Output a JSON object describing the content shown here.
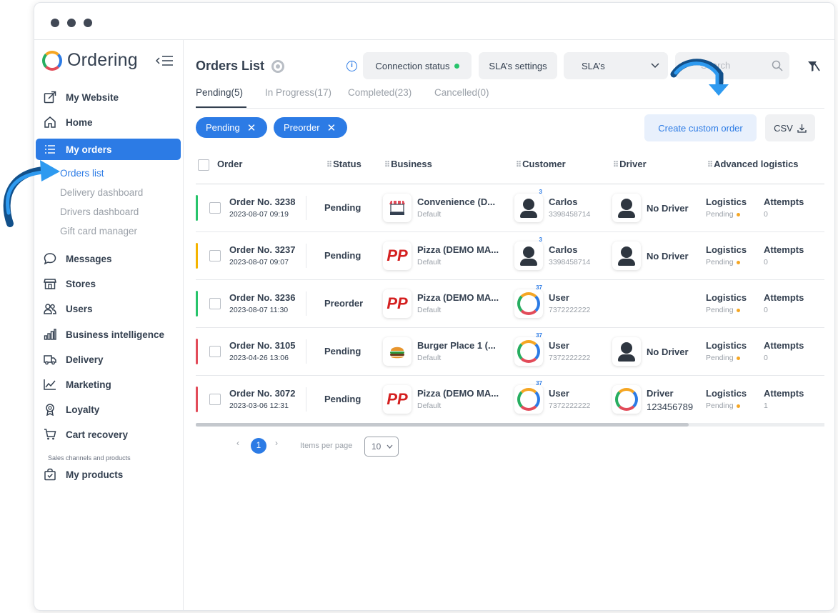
{
  "app": {
    "logo_text": "Ordering",
    "brand_color": "#2c7be5"
  },
  "sidebar": {
    "items": [
      {
        "label": "My Website",
        "icon": "external-link-icon"
      },
      {
        "label": "Home",
        "icon": "home-icon"
      },
      {
        "label": "My orders",
        "icon": "list-icon",
        "active": true
      },
      {
        "label": "Messages",
        "icon": "chat-icon"
      },
      {
        "label": "Stores",
        "icon": "store-icon"
      },
      {
        "label": "Users",
        "icon": "users-icon"
      },
      {
        "label": "Business intelligence",
        "icon": "bar-chart-icon"
      },
      {
        "label": "Delivery",
        "icon": "truck-icon"
      },
      {
        "label": "Marketing",
        "icon": "trend-icon"
      },
      {
        "label": "Loyalty",
        "icon": "award-icon"
      },
      {
        "label": "Cart recovery",
        "icon": "cart-icon"
      },
      {
        "label": "My products",
        "icon": "bag-icon"
      }
    ],
    "sub_items": [
      "Orders list",
      "Delivery dashboard",
      "Drivers dashboard",
      "Gift card manager"
    ],
    "section_label": "Sales channels and products"
  },
  "header": {
    "title": "Orders List",
    "connection_status": "Connection status",
    "sla_settings": "SLA’s settings",
    "sla_select": "SLA’s",
    "search_placeholder": "Search"
  },
  "tabs": [
    "Pending(5)",
    "In Progress(17)",
    "Completed(23)",
    "Cancelled(0)"
  ],
  "chips": [
    "Pending",
    "Preorder"
  ],
  "actions": {
    "create_custom_order": "Create custom order",
    "csv": "CSV"
  },
  "table": {
    "columns": [
      "Order",
      "Status",
      "Business",
      "Customer",
      "Driver",
      "Advanced logistics"
    ],
    "rows": [
      {
        "order": "Order No. 3238",
        "date": "2023-08-07 09:19",
        "status": "Pending",
        "business": "Convenience (D...",
        "business_sub": "Default",
        "customer": "Carlos",
        "phone": "3398458714",
        "badge": "3",
        "driver": "No Driver",
        "driver_sub": "",
        "logistics": "Logistics",
        "logistics_status": "Pending",
        "attempts_label": "Attempts",
        "attempts": "0",
        "bar_color": "#27c46b"
      },
      {
        "order": "Order No. 3237",
        "date": "2023-08-07 09:07",
        "status": "Pending",
        "business": "Pizza (DEMO MA...",
        "business_sub": "Default",
        "customer": "Carlos",
        "phone": "3398458714",
        "badge": "3",
        "driver": "No Driver",
        "driver_sub": "",
        "logistics": "Logistics",
        "logistics_status": "Pending",
        "attempts_label": "Attempts",
        "attempts": "0",
        "bar_color": "#f5b400"
      },
      {
        "order": "Order No. 3236",
        "date": "2023-08-07 11:30",
        "status": "Preorder",
        "business": "Pizza (DEMO MA...",
        "business_sub": "Default",
        "customer": "User",
        "phone": "7372222222",
        "badge": "37",
        "driver": "",
        "driver_sub": "",
        "logistics": "Logistics",
        "logistics_status": "Pending",
        "attempts_label": "Attempts",
        "attempts": "0",
        "bar_color": "#27c46b"
      },
      {
        "order": "Order No. 3105",
        "date": "2023-04-26 13:06",
        "status": "Pending",
        "business": "Burger Place 1 (...",
        "business_sub": "Default",
        "customer": "User",
        "phone": "7372222222",
        "badge": "37",
        "driver": "No Driver",
        "driver_sub": "",
        "logistics": "Logistics",
        "logistics_status": "Pending",
        "attempts_label": "Attempts",
        "attempts": "0",
        "bar_color": "#e24b59"
      },
      {
        "order": "Order No. 3072",
        "date": "2023-03-06 12:31",
        "status": "Pending",
        "business": "Pizza (DEMO MA...",
        "business_sub": "Default",
        "customer": "User",
        "phone": "7372222222",
        "badge": "37",
        "driver": "Driver",
        "driver_sub": "123456789",
        "logistics": "Logistics",
        "logistics_status": "Pending",
        "attempts_label": "Attempts",
        "attempts": "1",
        "bar_color": "#e24b59"
      }
    ]
  },
  "pagination": {
    "current_page": "1",
    "items_per_page_label": "Items per page",
    "items_per_page": "10"
  }
}
